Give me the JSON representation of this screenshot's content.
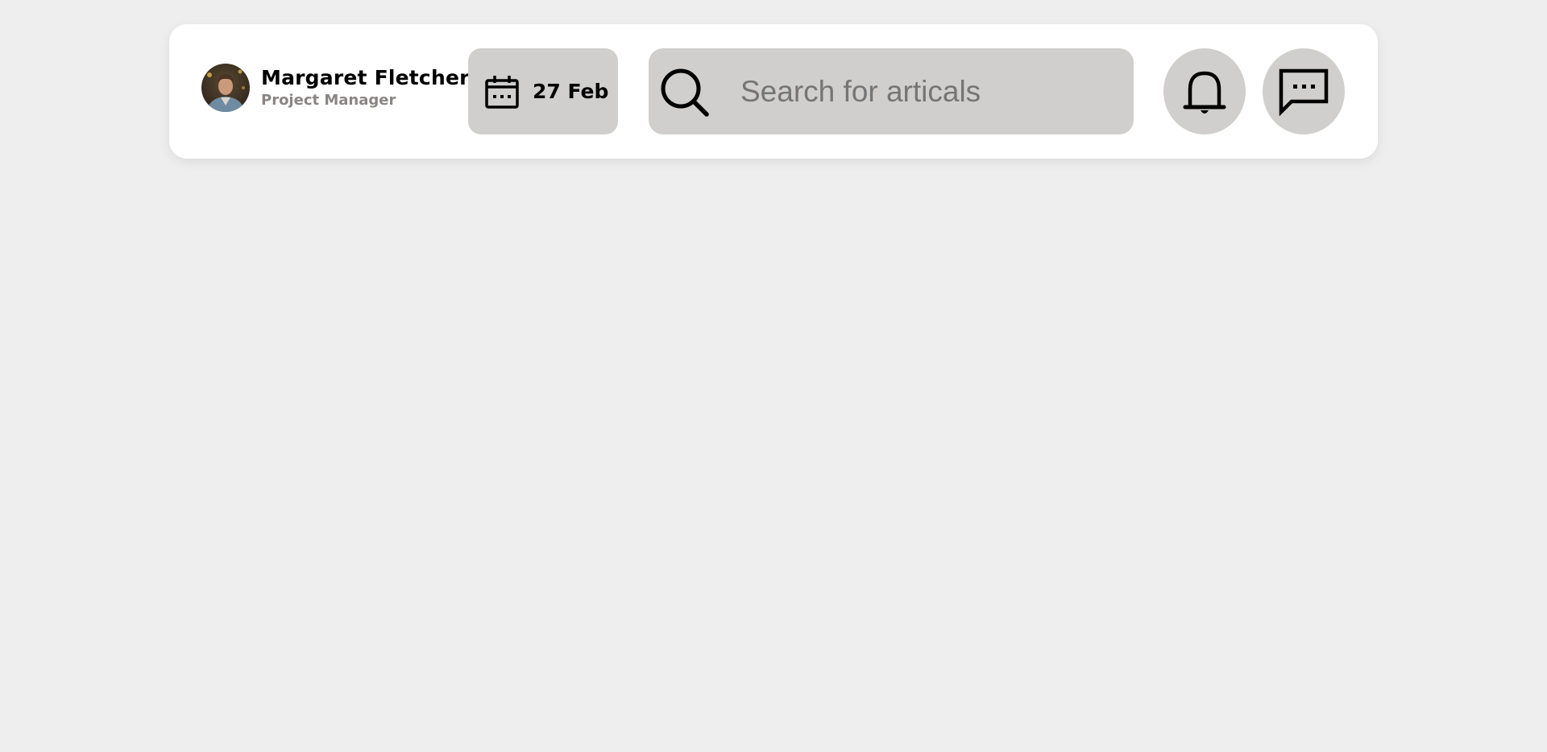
{
  "profile": {
    "name": "Margaret Fletcher",
    "role": "Project Manager",
    "avatar_icon": "user-avatar-photo"
  },
  "date": {
    "icon": "calendar-icon",
    "label": "27 Feb"
  },
  "search": {
    "icon": "search-icon",
    "placeholder": "Search for articals",
    "value": ""
  },
  "actions": {
    "notifications_icon": "bell-icon",
    "messages_icon": "chat-bubble-icon"
  },
  "colors": {
    "background": "#eeeeee",
    "card": "#ffffff",
    "pill": "#d0cfce",
    "role_text": "#8a8583"
  }
}
